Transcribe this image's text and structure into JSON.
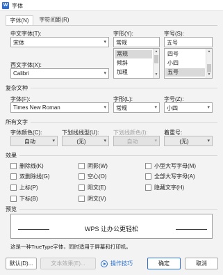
{
  "window": {
    "app_icon": "W",
    "title": "字体"
  },
  "tabs": [
    {
      "label": "字体(N)"
    },
    {
      "label": "字符间距(R)"
    }
  ],
  "cn_font": {
    "label": "中文字体(T):",
    "value": "宋体"
  },
  "font_style": {
    "label": "字形(Y):",
    "value": "常规",
    "options": [
      "常规",
      "倾斜",
      "加粗"
    ],
    "selected_index": 0
  },
  "font_size": {
    "label": "字号(S):",
    "value": "五号",
    "options": [
      "四号",
      "小四",
      "五号"
    ],
    "selected_index": 2
  },
  "west_font": {
    "label": "西文字体(X):",
    "value": "Calibri"
  },
  "complex": {
    "group_title": "复杂文种",
    "font_label": "字体(F):",
    "font_value": "Times New Roman",
    "style_label": "字形(L):",
    "style_value": "常规",
    "size_label": "字号(Z):",
    "size_value": "小四"
  },
  "all_text": {
    "group_title": "所有文字",
    "color_label": "字体颜色(C):",
    "color_value": "自动",
    "underline_label": "下划线线型(U):",
    "underline_value": "(无)",
    "ucolor_label": "下划线颜色(I):",
    "ucolor_value": "自动",
    "emph_label": "着重号:",
    "emph_value": "(无)"
  },
  "effects": {
    "group_title": "效果",
    "items": [
      "删除线(K)",
      "阴影(W)",
      "小型大写字母(M)",
      "双删除线(G)",
      "空心(O)",
      "全部大写字母(A)",
      "上标(P)",
      "阳文(E)",
      "隐藏文字(H)",
      "下标(B)",
      "阴文(V)"
    ]
  },
  "preview": {
    "group_title": "预览",
    "sample": "WPS 让办公更轻松"
  },
  "note": "这是一种TrueType字体，同时适用于屏幕和打印机。",
  "buttons": {
    "default": "默认(D)...",
    "text_effects": "文本效果(E)...",
    "tips": "操作技巧",
    "ok": "确定",
    "cancel": "取消"
  },
  "colors": {
    "accent": "#2c73d2",
    "app_icon": "#2b6fd6"
  }
}
